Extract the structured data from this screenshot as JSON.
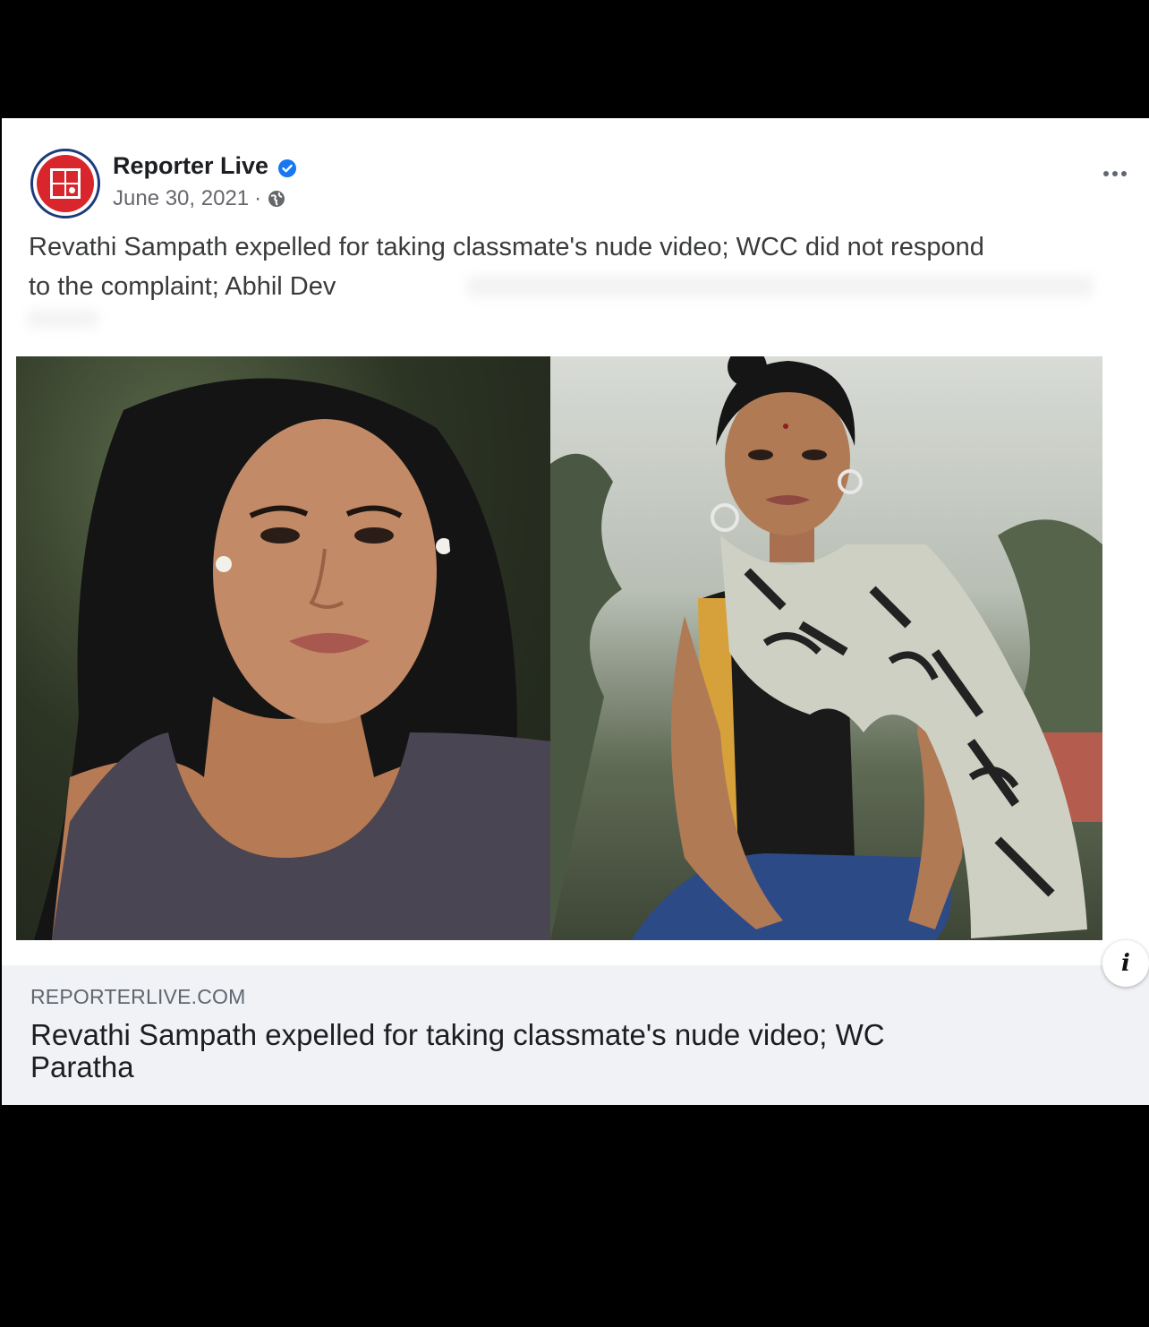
{
  "post": {
    "page_name": "Reporter Live",
    "date": "June 30, 2021",
    "separator": "·",
    "text": "Revathi Sampath expelled for taking classmate's nude video; WCC did not respond to the complaint; Abhil Dev",
    "more_icon": "ellipsis-icon",
    "verified_icon": "verified-badge-icon",
    "audience_icon": "globe-icon"
  },
  "link_preview": {
    "domain": "REPORTERLIVE.COM",
    "title": "Revathi Sampath expelled for taking classmate's nude video; WC Paratha"
  },
  "colors": {
    "brand_red": "#d8262c",
    "verified_blue": "#1877f2",
    "text_secondary": "#65676b"
  }
}
